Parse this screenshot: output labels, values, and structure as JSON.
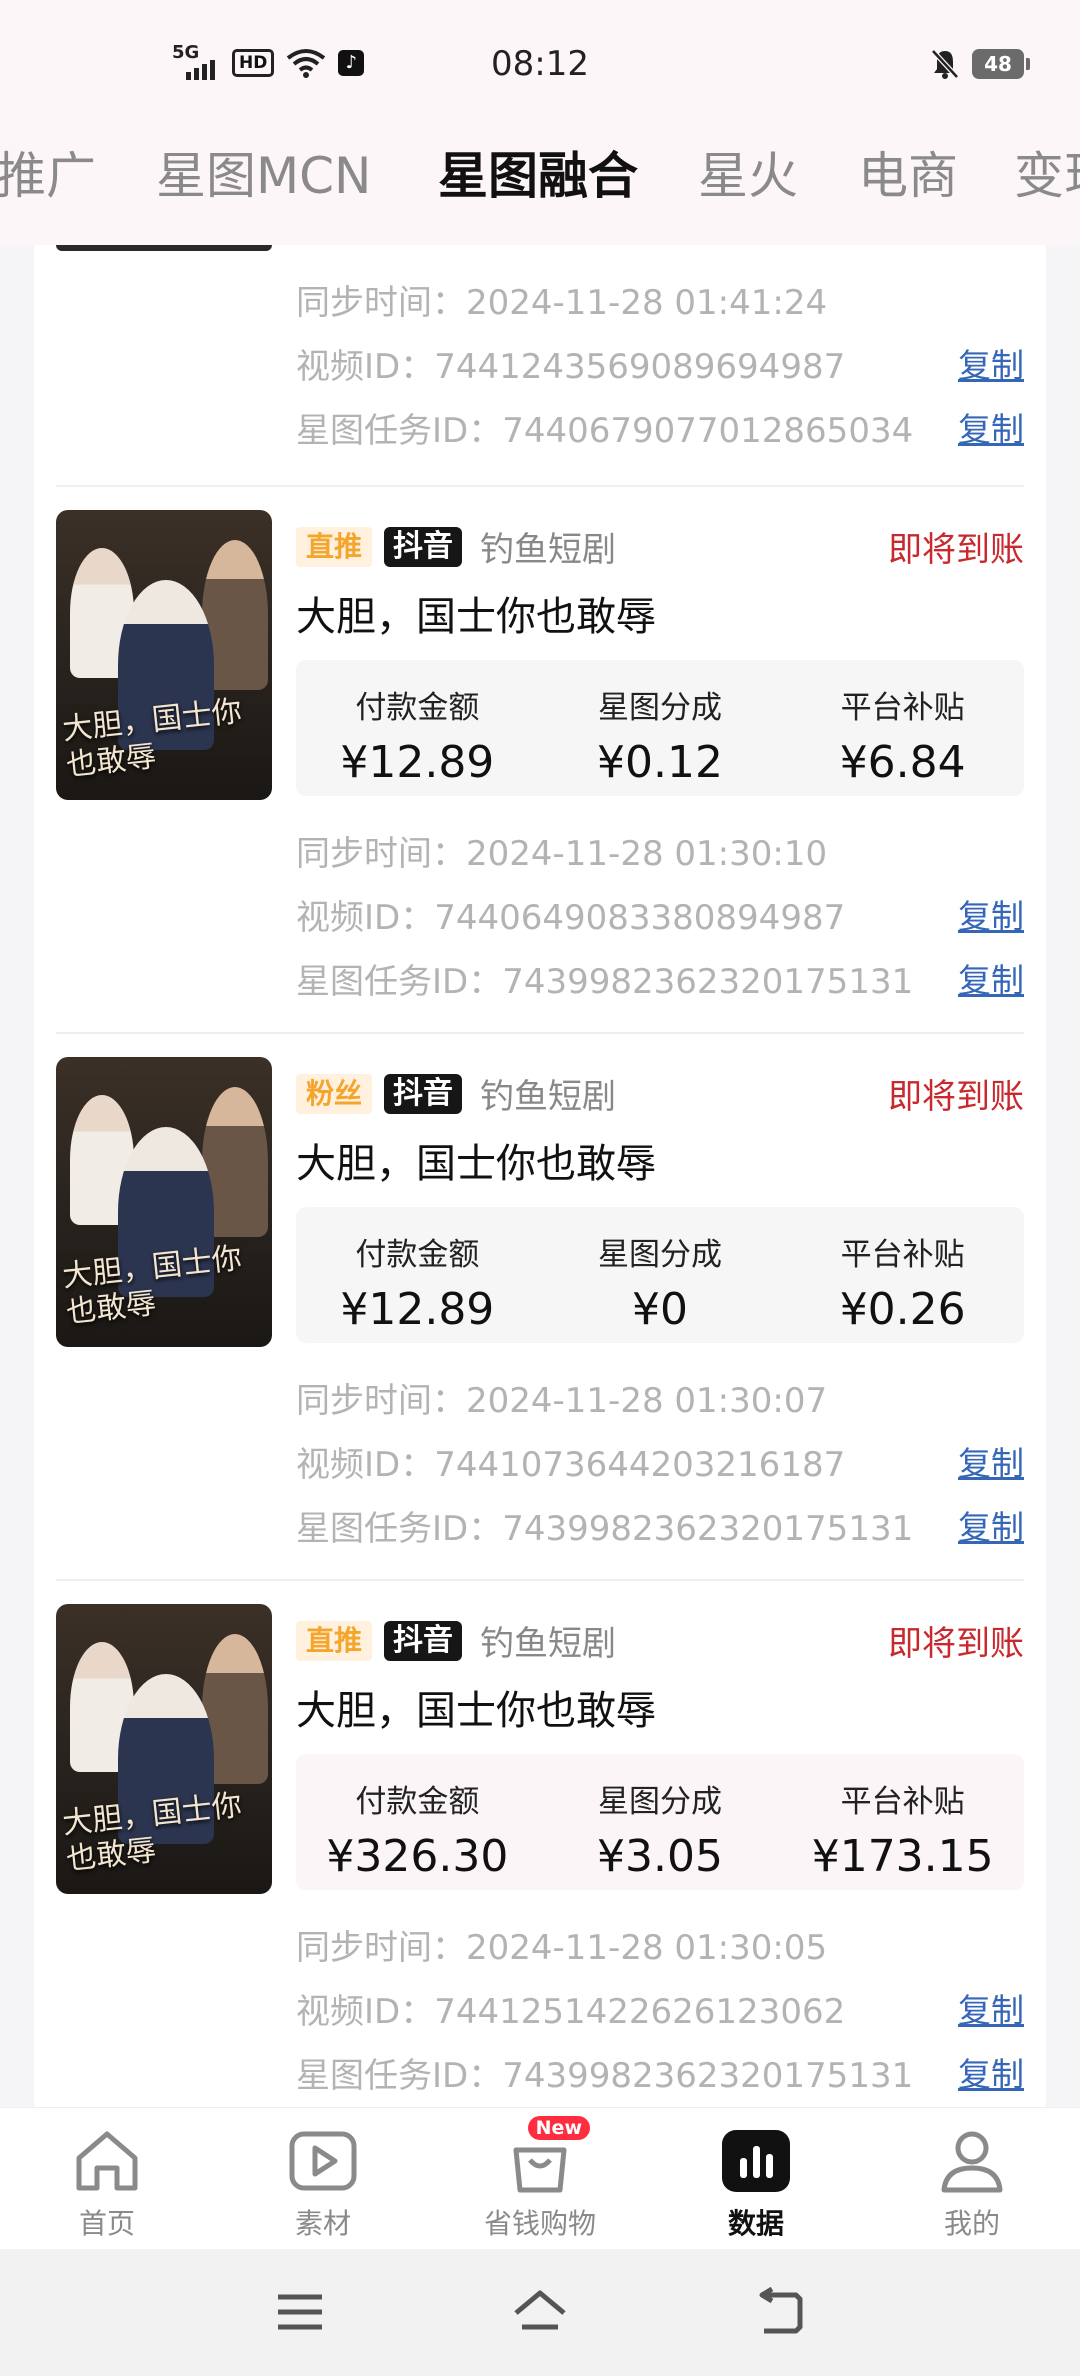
{
  "status_bar": {
    "network": "5G",
    "hd": "HD",
    "time": "08:12",
    "battery": "48"
  },
  "tabs": [
    "推广",
    "星图MCN",
    "星图融合",
    "星火",
    "电商",
    "变现"
  ],
  "active_tab": "星图融合",
  "partial_item": {
    "sync_time": "同步时间：2024-11-28 01:41:24",
    "video_id": "视频ID：7441243569089694987",
    "task_id": "星图任务ID：7440679077012865034",
    "copy": "复制"
  },
  "items": [
    {
      "tag_type": "直推",
      "platform": "抖音",
      "source": "钓鱼短剧",
      "state": "即将到账",
      "title": "大胆，国士你也敢辱",
      "thumb_caption": "大胆，国士你也敢辱",
      "labels": [
        "付款金额",
        "星图分成",
        "平台补贴"
      ],
      "values": [
        "¥12.89",
        "¥0.12",
        "¥6.84"
      ],
      "sync_time": "同步时间：2024-11-28 01:30:10",
      "video_id": "视频ID：7440649083380894987",
      "task_id": "星图任务ID：7439982362320175131",
      "copy": "复制"
    },
    {
      "tag_type": "粉丝",
      "platform": "抖音",
      "source": "钓鱼短剧",
      "state": "即将到账",
      "title": "大胆，国士你也敢辱",
      "thumb_caption": "大胆，国士你也敢辱",
      "labels": [
        "付款金额",
        "星图分成",
        "平台补贴"
      ],
      "values": [
        "¥12.89",
        "¥0",
        "¥0.26"
      ],
      "sync_time": "同步时间：2024-11-28 01:30:07",
      "video_id": "视频ID：7441073644203216187",
      "task_id": "星图任务ID：7439982362320175131",
      "copy": "复制"
    },
    {
      "tag_type": "直推",
      "platform": "抖音",
      "source": "钓鱼短剧",
      "state": "即将到账",
      "title": "大胆，国士你也敢辱",
      "thumb_caption": "大胆，国士你也敢辱",
      "labels": [
        "付款金额",
        "星图分成",
        "平台补贴"
      ],
      "values": [
        "¥326.30",
        "¥3.05",
        "¥173.15"
      ],
      "sync_time": "同步时间：2024-11-28 01:30:05",
      "video_id": "视频ID：7441251422626123062",
      "task_id": "星图任务ID：7439982362320175131",
      "copy": "复制"
    }
  ],
  "bottom_nav": [
    {
      "label": "首页",
      "icon": "home-icon"
    },
    {
      "label": "素材",
      "icon": "play-icon"
    },
    {
      "label": "省钱购物",
      "icon": "shopping-bag-icon",
      "badge": "New"
    },
    {
      "label": "数据",
      "icon": "bar-chart-icon",
      "active": true
    },
    {
      "label": "我的",
      "icon": "user-icon"
    }
  ],
  "colors": {
    "accent_red": "#c8282e",
    "link_blue": "#3566b8",
    "tag_orange": "#f4a52d",
    "badge_red": "#ff2d3f"
  }
}
